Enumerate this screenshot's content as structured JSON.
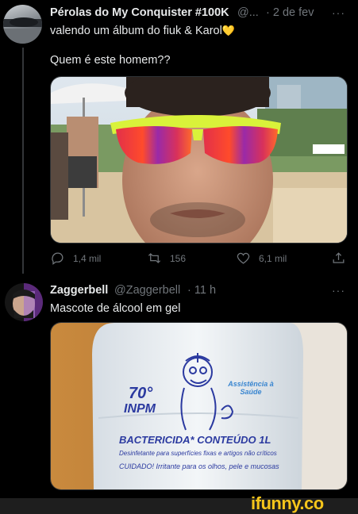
{
  "tweet1": {
    "display_name": "Pérolas do My Conquister #100K",
    "handle": "@...",
    "time": "· 2 de fev",
    "more": "···",
    "line1": "valendo um álbum do fiuk & Karol",
    "heart_emoji": "💛",
    "line2": "Quem é este homem??",
    "actions": {
      "reply": "1,4 mil",
      "retweet": "156",
      "like": "6,1 mil"
    }
  },
  "tweet2": {
    "display_name": "Zaggerbell",
    "handle": "@Zaggerbell",
    "time": "· 11 h",
    "more": "···",
    "text": "Mascote de álcool em gel",
    "bottle": {
      "grade": "70°",
      "unit": "INPM",
      "badge": "Assistência à Saúde",
      "product": "BACTERICIDA* CONTEÚDO 1L",
      "fine1": "Desinfetante para superfícies fixas e artigos não críticos",
      "fine2": "CUIDADO! Irritante para os olhos, pele e mucosas"
    }
  },
  "footer": {
    "brand": "ifunny.co"
  },
  "colors": {
    "background": "#000000",
    "text_primary": "#e7e9ea",
    "text_secondary": "#71767b",
    "brand_yellow": "#f5c51b"
  }
}
